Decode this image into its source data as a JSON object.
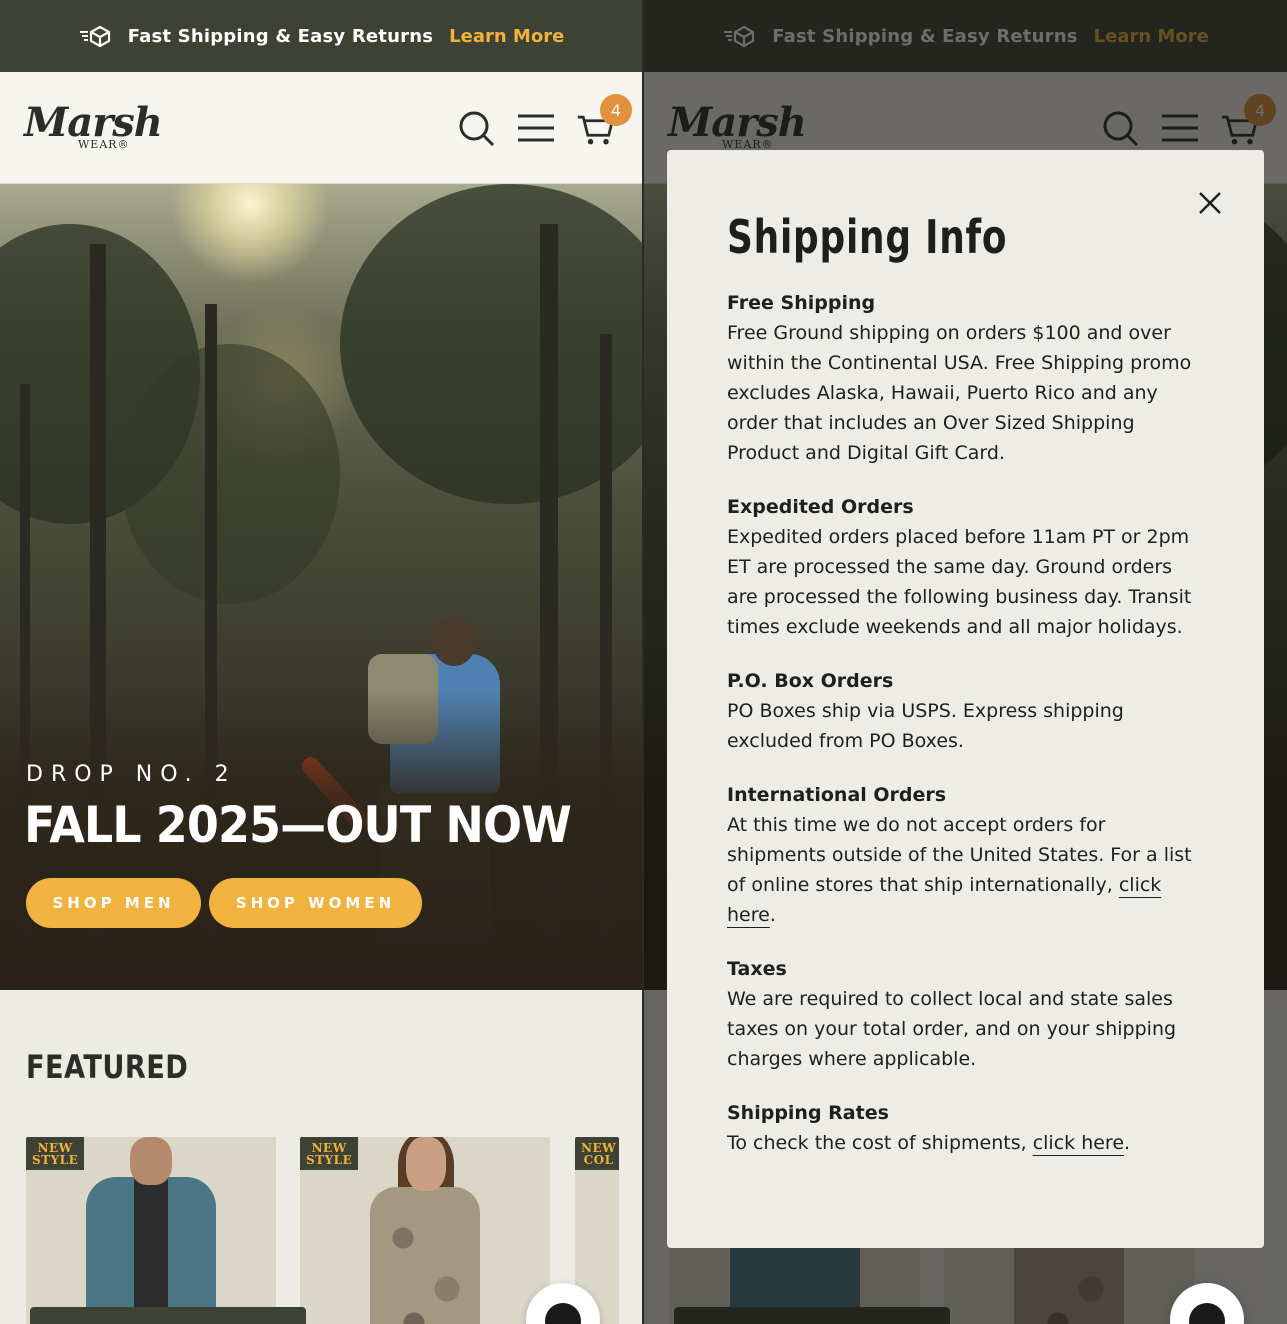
{
  "announcement": {
    "text": "Fast Shipping & Easy Returns",
    "link": "Learn More",
    "accent": "#f0b23b",
    "bg": "#3d4234"
  },
  "header": {
    "logo_script": "Marsh",
    "logo_sub": "WEAR®",
    "cart_count": "4"
  },
  "hero": {
    "kicker": "DROP NO. 2",
    "title": "FALL 2025—OUT NOW",
    "shop_men": "SHOP MEN",
    "shop_women": "SHOP WOMEN"
  },
  "featured": {
    "title": "FEATURED",
    "badges": [
      {
        "line1": "NEW",
        "line2": "STYLE"
      },
      {
        "line1": "NEW",
        "line2": "STYLE"
      },
      {
        "line1": "NEW",
        "line2": "COL"
      }
    ]
  },
  "modal": {
    "title": "Shipping Info",
    "sections": [
      {
        "heading": "Free Shipping",
        "body": "Free Ground shipping on orders $100 and over within the Continental USA. Free Shipping promo excludes Alaska, Hawaii, Puerto Rico and any order that includes an Over Sized Shipping Product and Digital Gift Card."
      },
      {
        "heading": "Expedited Orders",
        "body": "Expedited orders placed before 11am PT or 2pm ET are processed the same day. Ground orders are processed the following business day. Transit times exclude weekends and all major holidays."
      },
      {
        "heading": "P.O. Box Orders",
        "body": "PO Boxes ship via USPS. Express shipping excluded from PO Boxes."
      },
      {
        "heading": "International Orders",
        "body": "At this time we do not accept orders for shipments outside of the United States. For a list of online stores that ship internationally,",
        "link": "click here",
        "after": "."
      },
      {
        "heading": "Taxes",
        "body": "We are required to collect local and state sales taxes on your total order, and on your shipping charges where applicable."
      },
      {
        "heading": "Shipping Rates",
        "body": "To check the cost of shipments,",
        "link": "click here",
        "after": "."
      }
    ]
  },
  "icons": {
    "shipping": "shipping-box-icon",
    "search": "search-icon",
    "menu": "hamburger-menu-icon",
    "cart": "cart-icon",
    "close": "close-icon",
    "chat": "chat-icon"
  }
}
